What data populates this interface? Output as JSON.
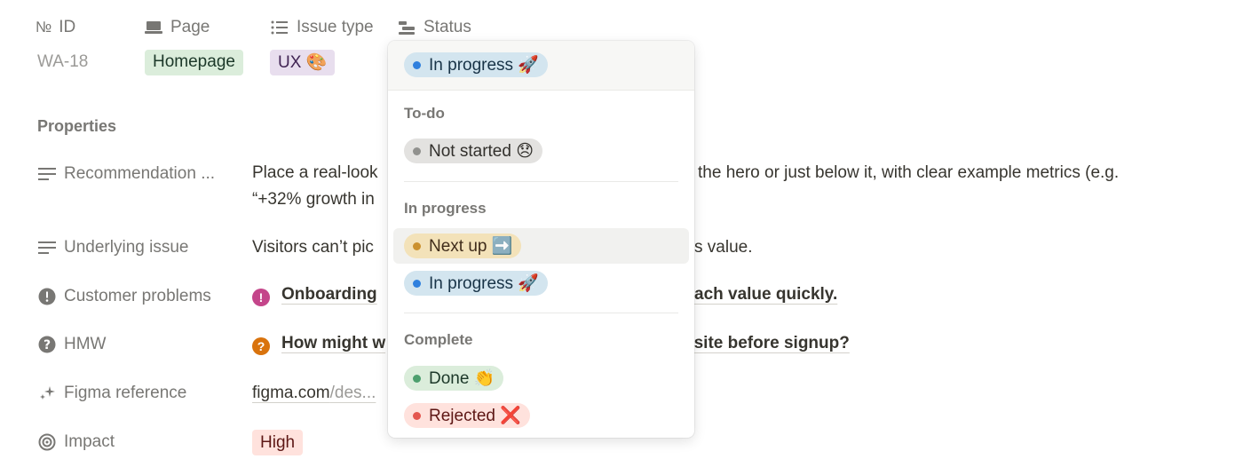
{
  "headers": {
    "id": "ID",
    "id_prefix": "№",
    "page": "Page",
    "issue_type": "Issue type",
    "status": "Status"
  },
  "row": {
    "id_value": "WA-18",
    "page_tag": "Homepage",
    "issue_tag": "UX 🎨"
  },
  "properties": {
    "title": "Properties",
    "items": [
      {
        "label": "Recommendation ...",
        "value_line1": "Place a real-look",
        "value_line1_right": "the hero or just below it, with clear example metrics (e.g.",
        "value_line2": "“+32% growth in",
        "icon": "text-lines-icon"
      },
      {
        "label": "Underlying issue",
        "value": "Visitors can’t pic",
        "value_right": "s value.",
        "icon": "text-lines-icon"
      },
      {
        "label": "Customer problems",
        "value": "Onboarding",
        "value_right": "ach value quickly.",
        "icon": "exclamation-icon"
      },
      {
        "label": "HMW",
        "value": "How might w",
        "value_right": "bsite before signup?",
        "icon": "question-icon"
      },
      {
        "label": "Figma reference",
        "value": "figma.com",
        "value_muted": "/des...",
        "icon": "sparkle-icon"
      },
      {
        "label": "Impact",
        "value": "High",
        "icon": "target-icon"
      }
    ]
  },
  "dropdown": {
    "selected": "In progress 🚀",
    "groups": [
      {
        "title": "To-do",
        "options": [
          "Not started 😞"
        ]
      },
      {
        "title": "In progress",
        "options": [
          "Next up ➡️",
          "In progress 🚀"
        ]
      },
      {
        "title": "Complete",
        "options": [
          "Done 👏",
          "Rejected ❌"
        ]
      }
    ]
  },
  "colors": {
    "blue_dot": "#2f80de",
    "gray_dot": "#91918e",
    "yellow_dot": "#cb912f",
    "green_dot": "#4d9f6e",
    "red_dot": "#e4574f"
  }
}
